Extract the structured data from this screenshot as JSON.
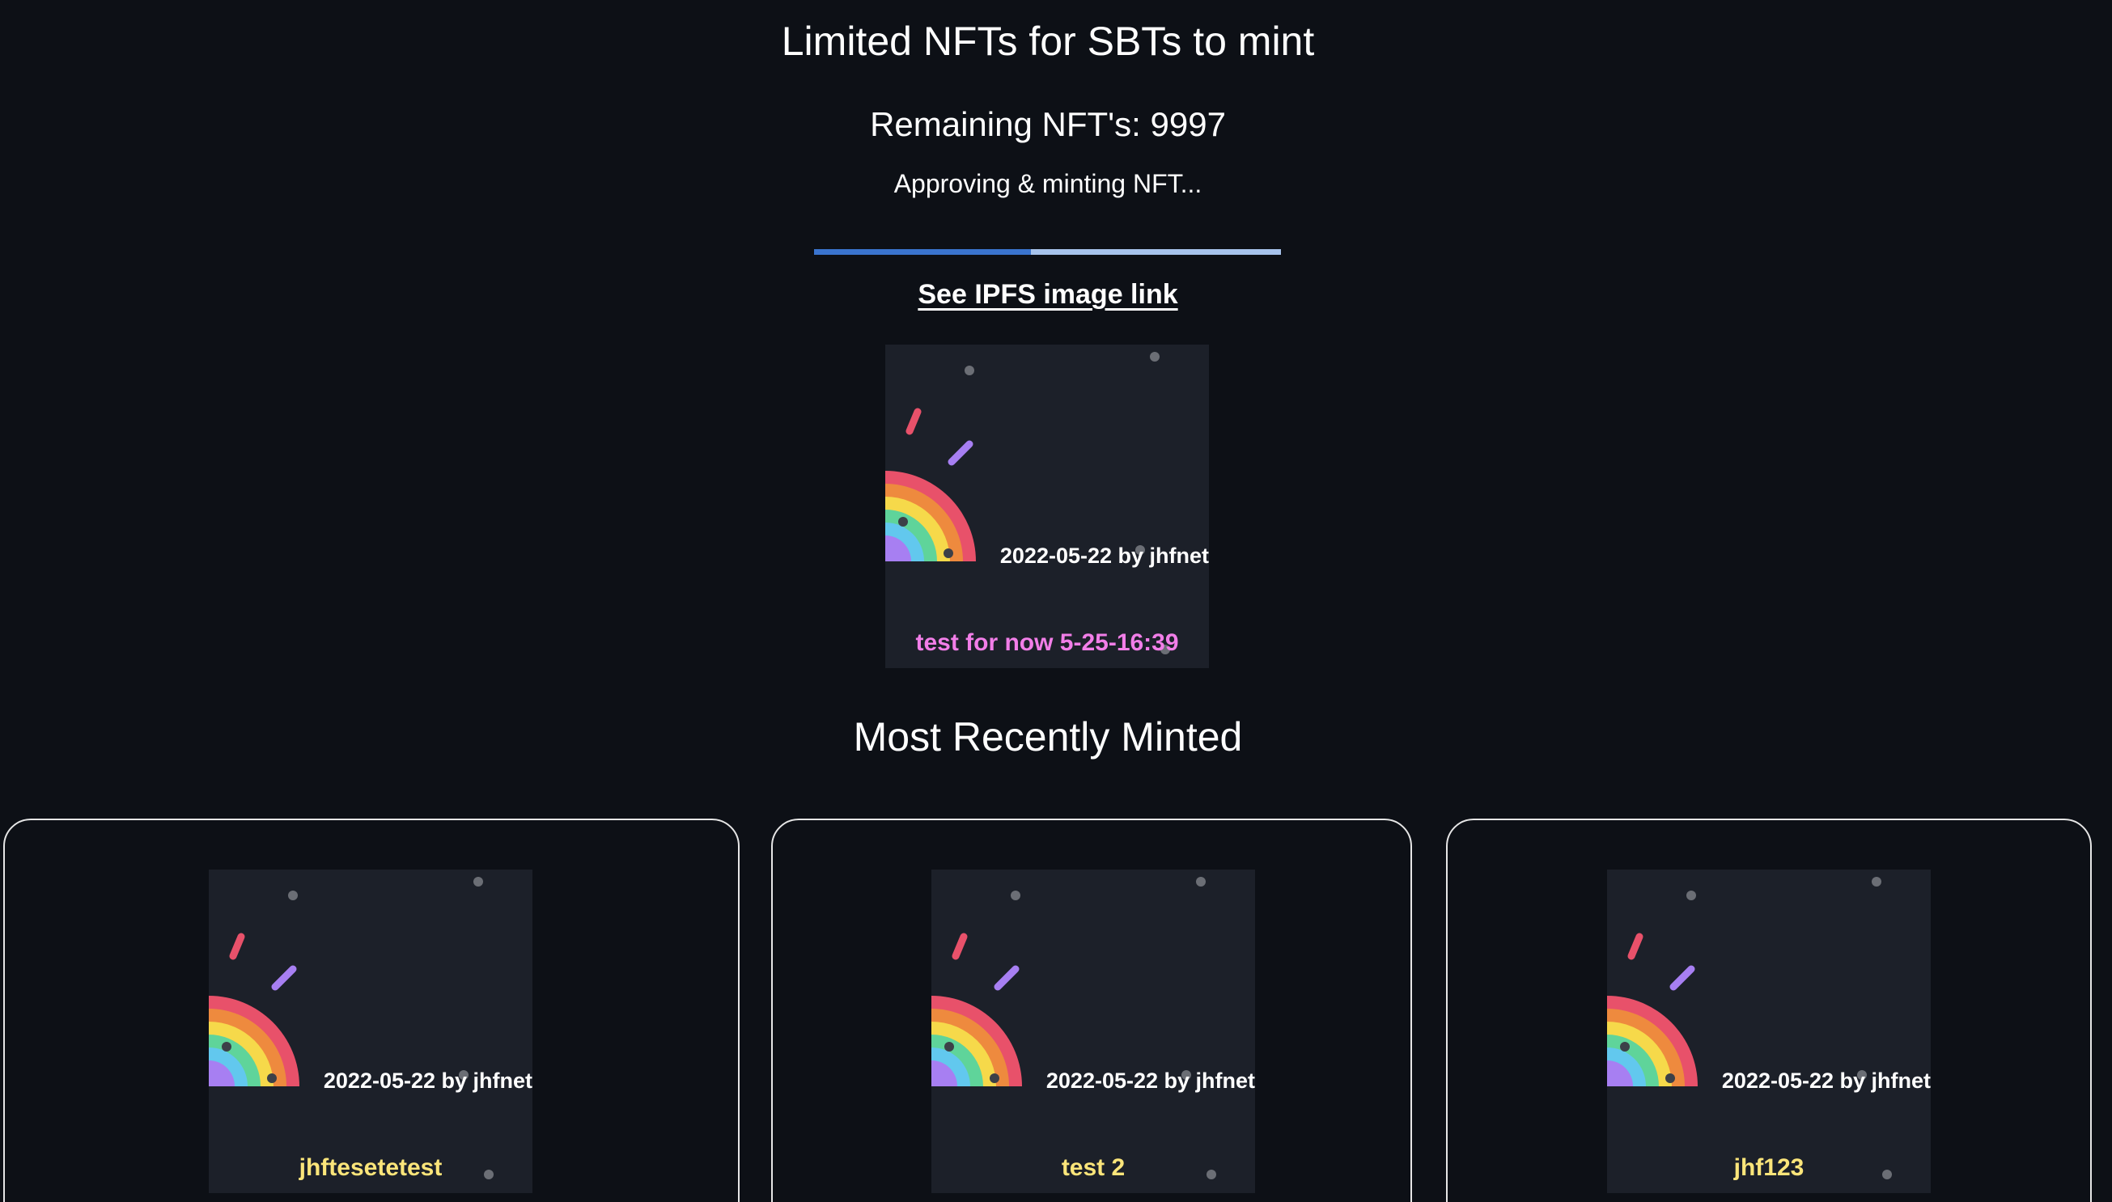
{
  "header": {
    "title": "Limited NFTs for SBTs to mint",
    "remaining": "Remaining NFT's: 9997",
    "status": "Approving & minting NFT...",
    "ipfs_link": "See IPFS image link"
  },
  "progress": {
    "fraction": 0.465,
    "fill_color": "#3a74cf",
    "track_color": "#a7c3ec"
  },
  "preview": {
    "date_line": "2022-05-22 by jhfnet",
    "name": "test for now 5-25-16:39",
    "name_color": "#f27ee8"
  },
  "recent": {
    "title": "Most Recently Minted",
    "items": [
      {
        "date_line": "2022-05-22 by jhfnet",
        "name": "jhftesetetest",
        "name_color": "#fbe57a"
      },
      {
        "date_line": "2022-05-22 by jhfnet",
        "name": "test 2",
        "name_color": "#fbe57a"
      },
      {
        "date_line": "2022-05-22 by jhfnet",
        "name": "jhf123",
        "name_color": "#fbe57a"
      }
    ]
  },
  "colors": {
    "background": "#0d1016",
    "image_background": "#1c2029",
    "rainbow": [
      "#e8516a",
      "#ee8a3e",
      "#f6d94a",
      "#5fd49a",
      "#62c8ee",
      "#a77ff2"
    ]
  }
}
